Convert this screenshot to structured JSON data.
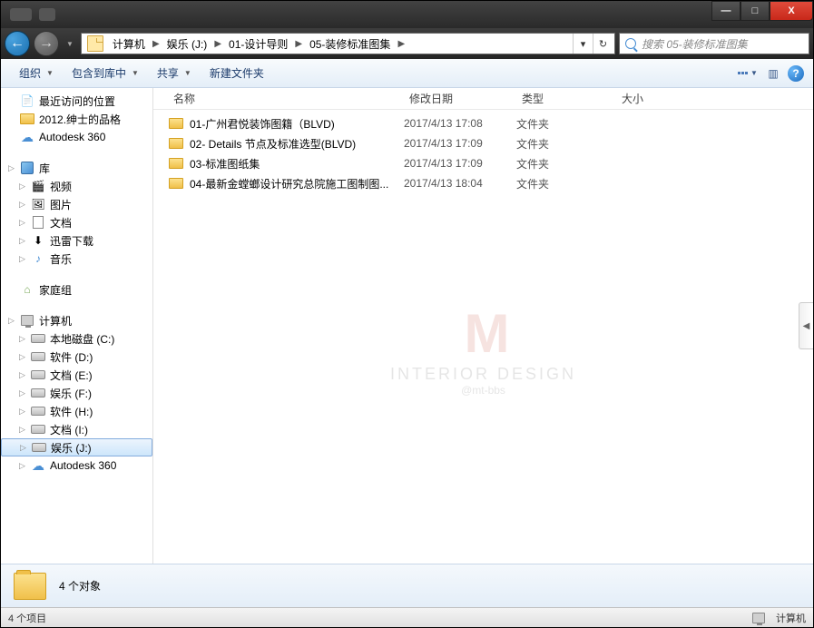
{
  "titlebar": {
    "blur1": "",
    "blur2": ""
  },
  "winControls": {
    "min": "—",
    "max": "□",
    "close": "X"
  },
  "breadcrumbs": [
    {
      "label": "计算机"
    },
    {
      "label": "娱乐 (J:)"
    },
    {
      "label": "01-设计导则"
    },
    {
      "label": "05-装修标准图集"
    }
  ],
  "search": {
    "placeholder": "搜索 05-装修标准图集"
  },
  "toolbar": {
    "organize": "组织",
    "include": "包含到库中",
    "share": "共享",
    "newFolder": "新建文件夹"
  },
  "columns": {
    "name": "名称",
    "date": "修改日期",
    "type": "类型",
    "size": "大小"
  },
  "files": [
    {
      "name": "01-广州君悦装饰图籍（BLVD)",
      "date": "2017/4/13 17:08",
      "type": "文件夹"
    },
    {
      "name": "02- Details 节点及标准选型(BLVD)",
      "date": "2017/4/13 17:09",
      "type": "文件夹"
    },
    {
      "name": "03-标准图纸集",
      "date": "2017/4/13 17:09",
      "type": "文件夹"
    },
    {
      "name": "04-最新金螳螂设计研究总院施工图制图...",
      "date": "2017/4/13 18:04",
      "type": "文件夹"
    }
  ],
  "sidebar": {
    "recent": "最近访问的位置",
    "fav1": "2012.绅士的品格",
    "autodesk": "Autodesk 360",
    "library": "库",
    "video": "视频",
    "picture": "图片",
    "document": "文档",
    "xunlei": "迅雷下载",
    "music": "音乐",
    "homegroup": "家庭组",
    "computer": "计算机",
    "localC": "本地磁盘 (C:)",
    "driveD": "软件 (D:)",
    "driveE": "文档 (E:)",
    "driveF": "娱乐 (F:)",
    "driveH": "软件 (H:)",
    "driveI": "文档 (I:)",
    "driveJ": "娱乐 (J:)",
    "autodesk2": "Autodesk 360"
  },
  "details": {
    "count": "4 个对象"
  },
  "statusbar": {
    "items": "4 个项目",
    "computer": "计算机"
  },
  "watermark": {
    "logo": "M",
    "text": "INTERIOR DESIGN",
    "sub": "@mt-bbs"
  }
}
